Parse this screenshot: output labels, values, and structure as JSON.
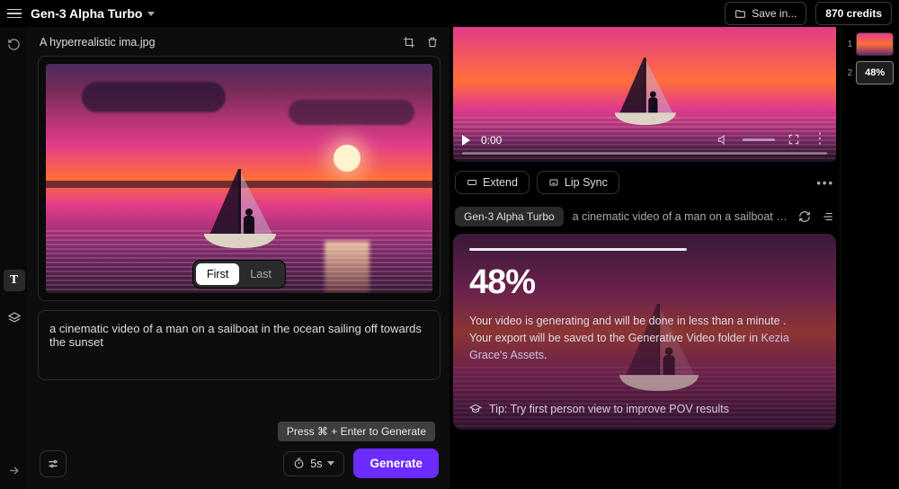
{
  "header": {
    "model": "Gen-3 Alpha Turbo",
    "save_label": "Save in...",
    "credits": "870 credits"
  },
  "source": {
    "filename": "A hyperrealistic ima.jpg",
    "frame_first": "First",
    "frame_last": "Last"
  },
  "prompt": {
    "text": "a cinematic video of a man on a sailboat in the ocean sailing off towards the sunset"
  },
  "generate": {
    "tooltip": "Press ⌘ + Enter to Generate",
    "duration": "5s",
    "button": "Generate"
  },
  "preview": {
    "time": "0:00",
    "extend": "Extend",
    "lipsync": "Lip Sync"
  },
  "job": {
    "model": "Gen-3 Alpha Turbo",
    "prompt_truncated": "a cinematic video of a man on a sailboat in the oc...",
    "progress_percent": "48%",
    "line1": "Your video is generating and will be done in less than a minute .",
    "line2_prefix": "Your export will be saved to the Generative Video folder in ",
    "line2_link": "Kezia Grace's Assets",
    "line2_suffix": ".",
    "tip": "Tip: Try first person view to improve POV results"
  },
  "queue": {
    "items": [
      {
        "index": "1",
        "type": "thumb"
      },
      {
        "index": "2",
        "type": "progress",
        "label": "48%"
      }
    ]
  }
}
